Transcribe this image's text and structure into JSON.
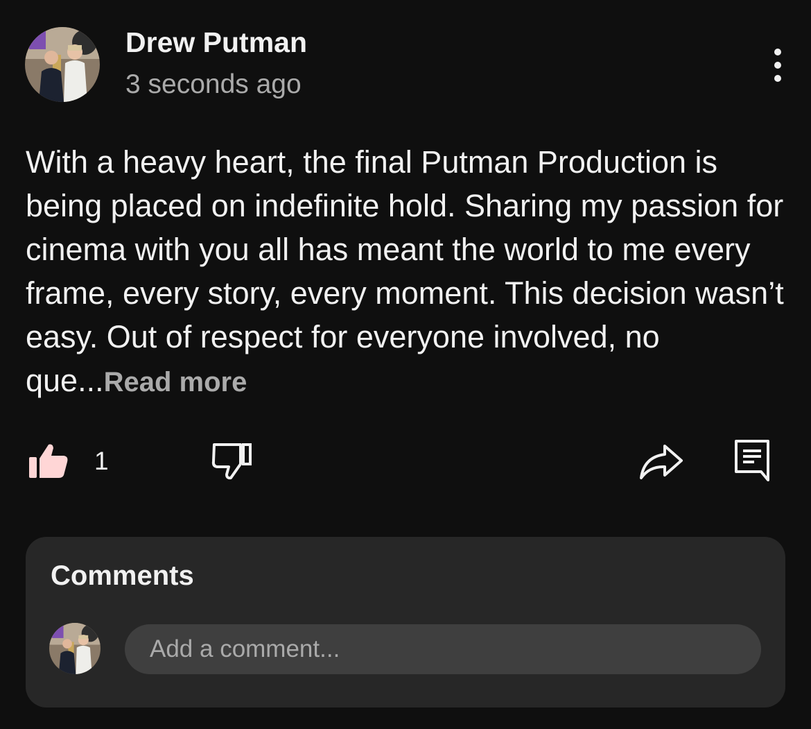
{
  "post": {
    "author": "Drew Putman",
    "timestamp": "3 seconds ago",
    "body": "With a heavy heart, the final Putman Production is being placed on indefinite hold. Sharing my passion for cinema with you all has meant the world to me every frame, every story, every moment. This decision wasn’t easy. Out of respect for everyone involved, no que...",
    "read_more": "Read more"
  },
  "actions": {
    "like_count": "1",
    "like_icon": "thumbs-up-filled-icon",
    "dislike_icon": "thumbs-down-icon",
    "share_icon": "share-arrow-icon",
    "reply_icon": "comment-icon",
    "menu_icon": "more-vertical-icon"
  },
  "comments": {
    "heading": "Comments",
    "input_placeholder": "Add a comment..."
  },
  "colors": {
    "background": "#0f0f0f",
    "panel": "#272727",
    "input": "#3f3f3f",
    "text_primary": "#f1f1f1",
    "text_secondary": "#aaaaaa",
    "like_fill": "#ffd6d6"
  }
}
